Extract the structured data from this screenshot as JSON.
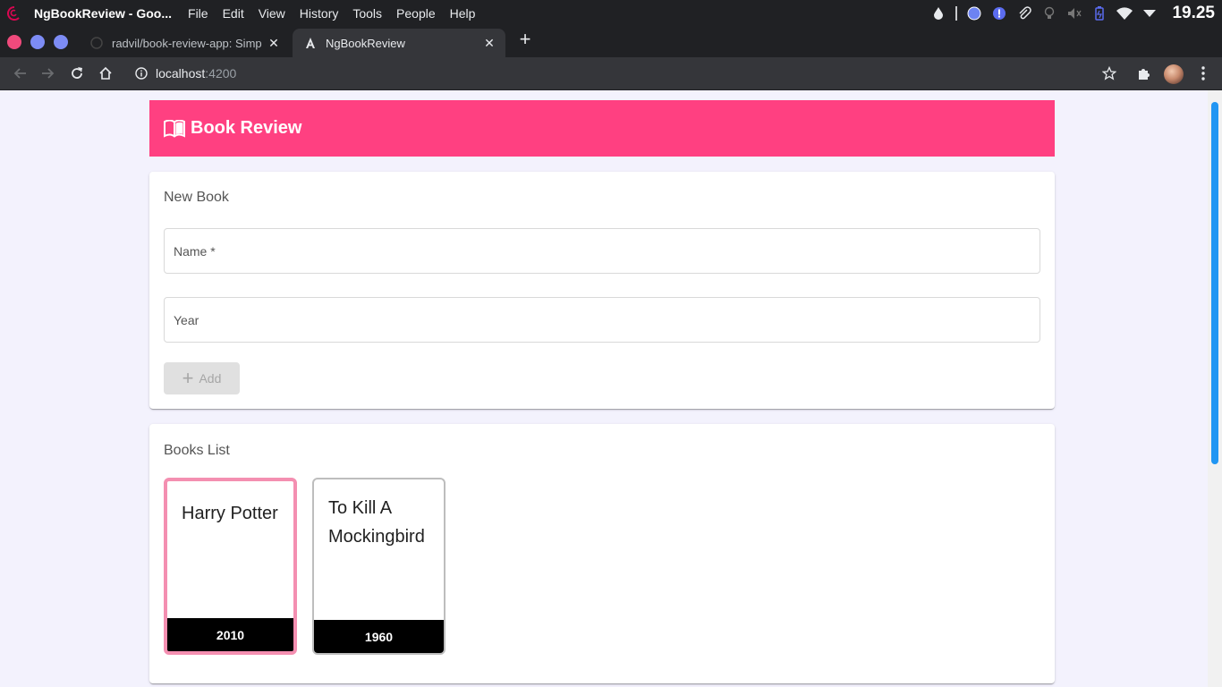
{
  "system": {
    "window_title": "NgBookReview - Goo...",
    "menu": [
      "File",
      "Edit",
      "View",
      "History",
      "Tools",
      "People",
      "Help"
    ],
    "clock": "19.25"
  },
  "tabs": [
    {
      "label": "radvil/book-review-app: Simp",
      "active": false
    },
    {
      "label": "NgBookReview",
      "active": true
    }
  ],
  "address_bar": {
    "host": "localhost",
    "port": ":4200"
  },
  "app": {
    "title": "Book Review",
    "new_book": {
      "title": "New Book",
      "name_placeholder": "Name *",
      "year_placeholder": "Year",
      "add_label": "Add"
    },
    "books_list": {
      "title": "Books List",
      "books": [
        {
          "name": "Harry Potter",
          "year": "2010",
          "selected": true
        },
        {
          "name": "To Kill A Mockingbird",
          "year": "1960",
          "selected": false
        }
      ]
    }
  },
  "colors": {
    "accent": "#ff4081",
    "selected_border": "#f48fb1",
    "scrollbar_thumb": "#2196f3"
  }
}
